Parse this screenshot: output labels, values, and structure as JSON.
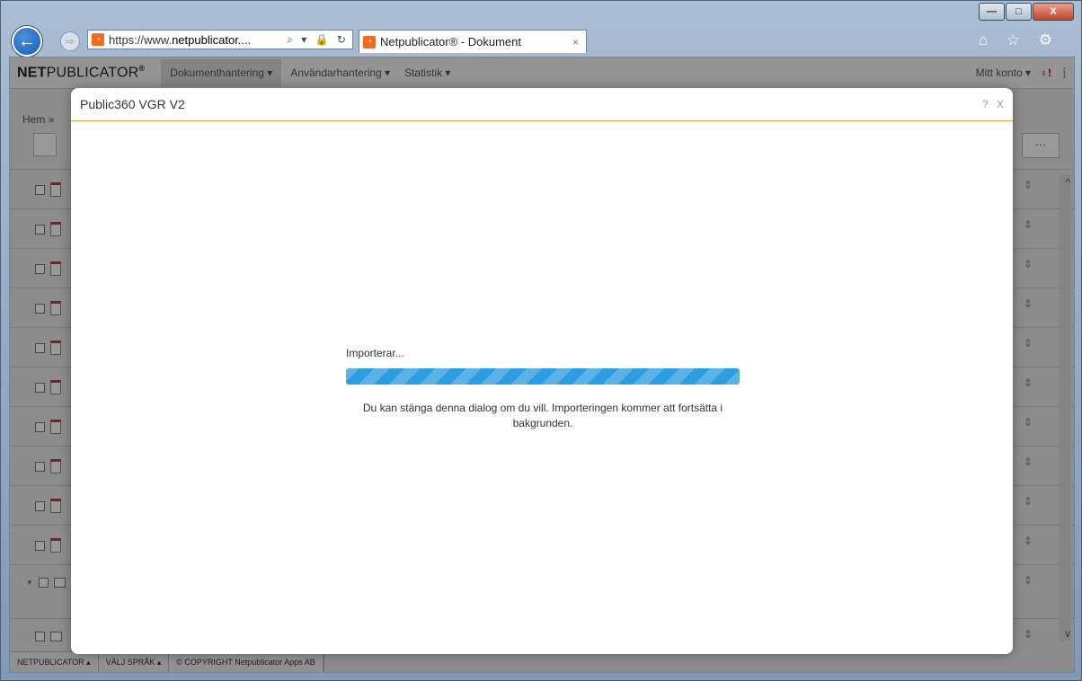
{
  "browser": {
    "url_prefix": "https://www.",
    "url_domain": "netpublicator....",
    "address_tools": "⌕ ▾ 🔒 ↻",
    "tab_title": "Netpublicator® - Dokument",
    "tab_close": "×",
    "right_icons": "⌂ ☆ ⚙",
    "back_icon": "←",
    "forward_icon": "⇨"
  },
  "window": {
    "minimize": "—",
    "maximize": "□",
    "close": "X"
  },
  "app": {
    "logo_bold": "NET",
    "logo_rest": "PUBLICATOR",
    "logo_mark": "®",
    "nav": [
      {
        "label": "Dokumenthantering ▾"
      },
      {
        "label": "Användarhantering ▾"
      },
      {
        "label": "Statistik ▾"
      }
    ],
    "account": "Mitt konto ▾",
    "notif_icon": "♁",
    "notif_badge": "!",
    "info": "i",
    "breadcrumb": "Hem »",
    "more": "···"
  },
  "footer": {
    "items": [
      "NETPUBLICATOR ▴",
      "VÄLJ SPRÅK ▴",
      "© COPYRIGHT Netpublicator Apps AB"
    ]
  },
  "modal": {
    "title": "Public360 VGR V2",
    "help": "?",
    "close": "X",
    "status": "Importerar...",
    "progress": 1.0,
    "message": "Du kan stänga denna dialog om du vill. Importeringen kommer att fortsätta i bakgrunden."
  },
  "colors": {
    "accent": "#e8a23a",
    "progress": "#2b9de0"
  }
}
